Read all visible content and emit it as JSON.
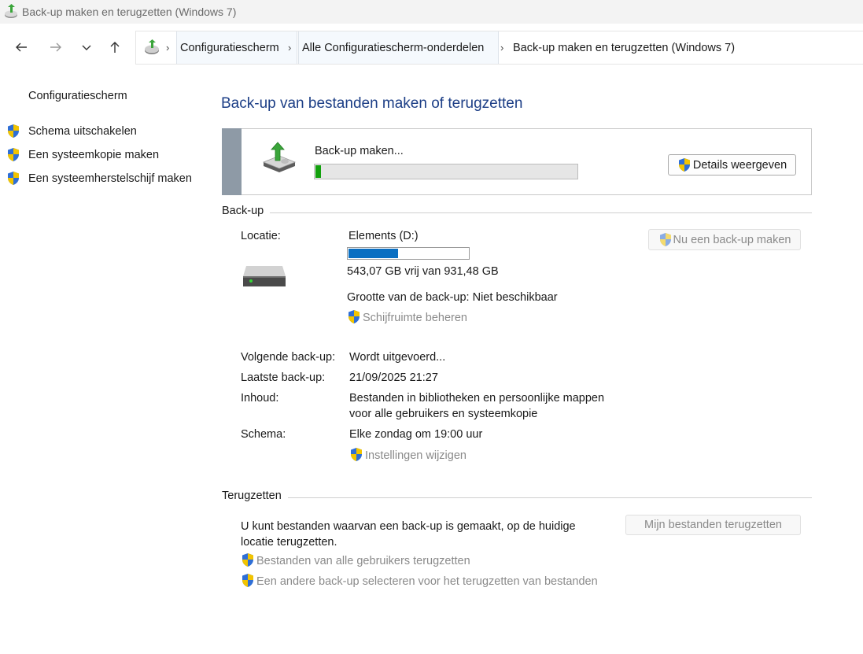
{
  "window": {
    "title": "Back-up maken en terugzetten (Windows 7)"
  },
  "navigation": {
    "breadcrumbs": [
      "Configuratiescherm",
      "Alle Configuratiescherm-onderdelen",
      "Back-up maken en terugzetten (Windows 7)"
    ]
  },
  "sidebar": {
    "home": "Configuratiescherm",
    "items": [
      "Schema uitschakelen",
      "Een systeemkopie maken",
      "Een systeemherstelschijf maken"
    ]
  },
  "main": {
    "heading": "Back-up van bestanden maken of terugzetten",
    "progress": {
      "label": "Back-up maken...",
      "fraction": 0.02,
      "details_button": "Details weergeven"
    },
    "backup": {
      "section_title": "Back-up",
      "location_label": "Locatie:",
      "location_value": "Elements (D:)",
      "disk_used_fraction": 0.417,
      "free_space": "543,07 GB vrij van 931,48 GB",
      "size": "Grootte van de back-up: Niet beschikbaar",
      "manage_space": "Schijfruimte beheren",
      "backup_now_button": "Nu een back-up maken",
      "rows": [
        {
          "label": "Volgende back-up:",
          "value": "Wordt uitgevoerd..."
        },
        {
          "label": "Laatste back-up:",
          "value": "21/09/2025 21:27"
        },
        {
          "label": "Inhoud:",
          "value": "Bestanden in bibliotheken en persoonlijke mappen",
          "value2": "voor alle gebruikers en systeemkopie"
        },
        {
          "label": "Schema:",
          "value": "Elke zondag om 19:00 uur"
        }
      ],
      "change_settings": "Instellingen wijzigen"
    },
    "restore": {
      "section_title": "Terugzetten",
      "desc_line1": "U kunt bestanden waarvan een back-up is gemaakt, op de huidige",
      "desc_line2": "locatie terugzetten.",
      "restore_button": "Mijn bestanden terugzetten",
      "links": [
        "Bestanden van alle gebruikers terugzetten",
        "Een andere back-up selecteren voor het terugzetten van bestanden"
      ]
    }
  },
  "colors": {
    "heading": "#1c3e86",
    "progress_fill": "#13a10e",
    "disk_fill": "#0a6fc2"
  }
}
